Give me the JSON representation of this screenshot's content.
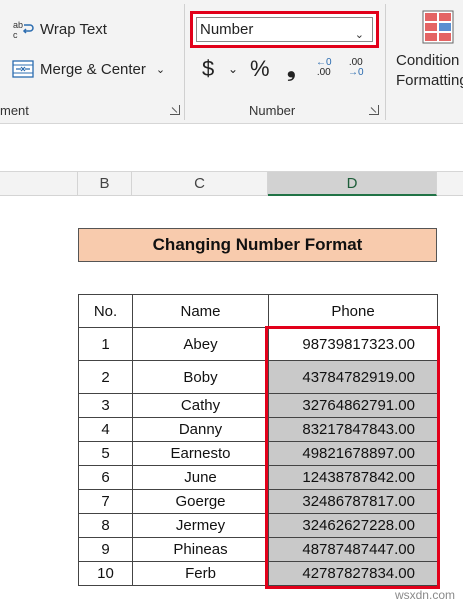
{
  "ribbon": {
    "wrap_text": "Wrap Text",
    "merge_center": "Merge & Center",
    "alignment_group": "ment",
    "number_format_value": "Number",
    "number_group": "Number",
    "currency_symbol": "$",
    "percent_symbol": "%",
    "comma_symbol": "❟",
    "increase_decimal_top": "←0",
    "increase_decimal_bottom": ".00",
    "decrease_decimal_top": ".00",
    "decrease_decimal_bottom": "→0",
    "conditional_line1": "Condition",
    "conditional_line2": "Formatting"
  },
  "columns": [
    "B",
    "C",
    "D"
  ],
  "sheet": {
    "title": "Changing Number Format",
    "headers": {
      "no": "No.",
      "name": "Name",
      "phone": "Phone"
    },
    "rows": [
      {
        "no": "1",
        "name": "Abey",
        "phone": "98739817323.00"
      },
      {
        "no": "2",
        "name": "Boby",
        "phone": "43784782919.00"
      },
      {
        "no": "3",
        "name": "Cathy",
        "phone": "32764862791.00"
      },
      {
        "no": "4",
        "name": "Danny",
        "phone": "83217847843.00"
      },
      {
        "no": "5",
        "name": "Earnesto",
        "phone": "49821678897.00"
      },
      {
        "no": "6",
        "name": "June",
        "phone": "12438787842.00"
      },
      {
        "no": "7",
        "name": "Goerge",
        "phone": "32486787817.00"
      },
      {
        "no": "8",
        "name": "Jermey",
        "phone": "32462627228.00"
      },
      {
        "no": "9",
        "name": "Phineas",
        "phone": "48787487447.00"
      },
      {
        "no": "10",
        "name": "Ferb",
        "phone": "42787827834.00"
      }
    ]
  },
  "watermark": "wsxdn.com",
  "colors": {
    "highlight_red": "#e2001a",
    "title_fill": "#f8cbad",
    "selected_fill": "#c9c9c9",
    "excel_green": "#217346"
  }
}
